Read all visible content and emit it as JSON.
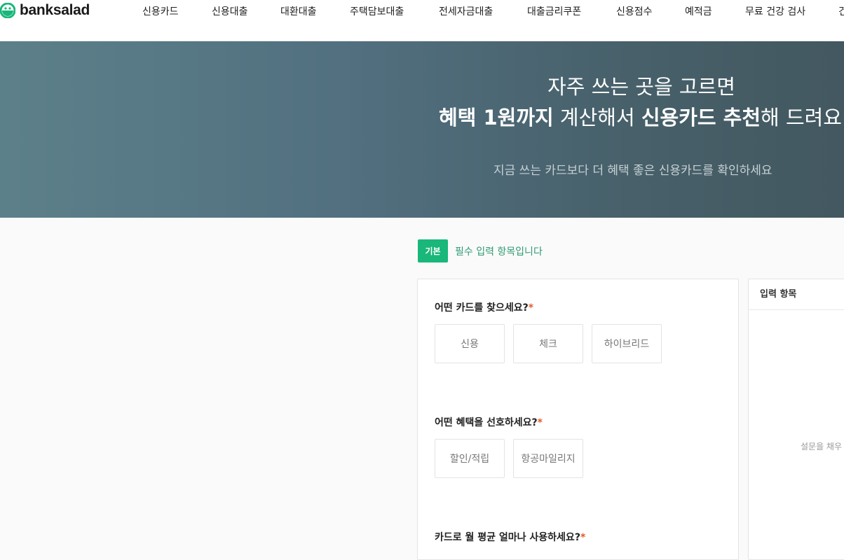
{
  "header": {
    "logo_text": "banksalad",
    "nav": [
      "신용카드",
      "신용대출",
      "대환대출",
      "주택담보대출",
      "전세자금대출",
      "대출금리쿠폰",
      "신용점수",
      "예적금",
      "무료 건강 검사",
      "건"
    ]
  },
  "hero": {
    "line1": "자주 쓰는 곳을 고르면",
    "line2_a": "혜택 1원까지",
    "line2_b": " 계산해서 ",
    "line2_c": "신용카드 추천",
    "line2_d": "해 드려요",
    "sub": "지금 쓰는 카드보다 더 혜택 좋은 신용카드를 확인하세요"
  },
  "section": {
    "badge": "기본",
    "note": "필수 입력 항목입니다"
  },
  "form": {
    "q1": "어떤 카드를 찾으세요?",
    "q1_options": [
      "신용",
      "체크",
      "하이브리드"
    ],
    "q2": "어떤 혜택을 선호하세요?",
    "q2_options": [
      "할인/적립",
      "항공마일리지"
    ],
    "q3": "카드로 월 평균 얼마나 사용하세요?",
    "required_mark": "*"
  },
  "side": {
    "title": "입력 항목",
    "empty_text": "설문을 채우"
  },
  "colors": {
    "accent_green": "#19b77a",
    "required_orange": "#e35a2a"
  }
}
